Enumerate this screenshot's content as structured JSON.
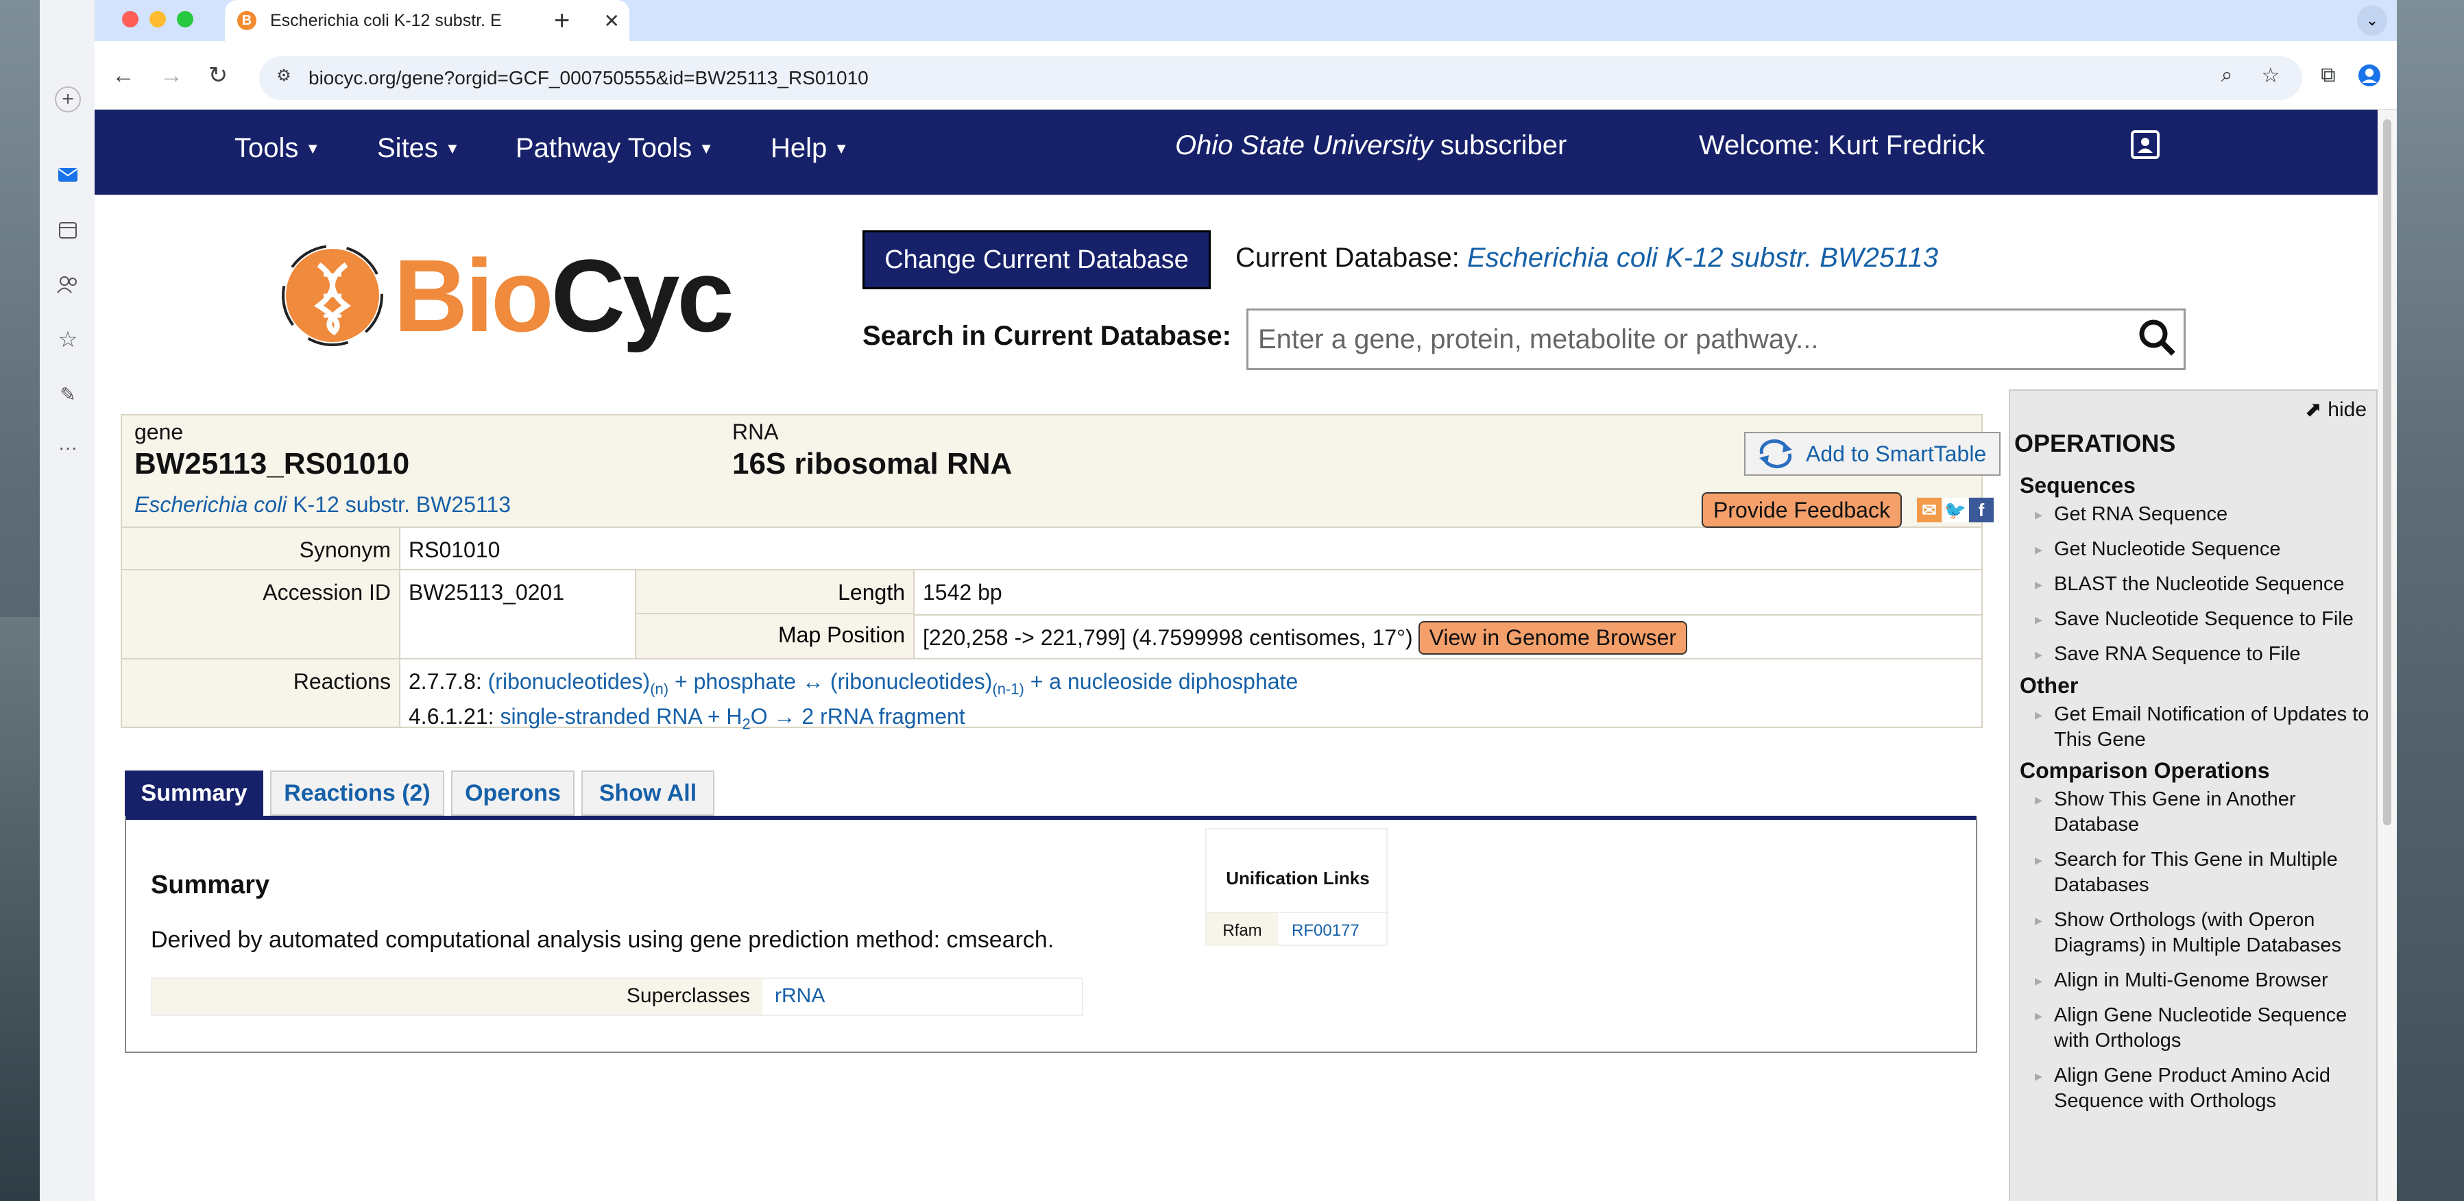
{
  "browser": {
    "tab_title": "Escherichia coli K-12 substr. E",
    "url": "biocyc.org/gene?orgid=GCF_000750555&id=BW25113_RS01010",
    "favicon_letter": "B"
  },
  "nav": {
    "menus": [
      "Tools",
      "Sites",
      "Pathway Tools",
      "Help"
    ],
    "subscriber_org": "Ohio State University",
    "subscriber_suffix": "subscriber",
    "welcome": "Welcome: Kurt Fredrick"
  },
  "logo": {
    "part1": "Bio",
    "part2": "Cyc"
  },
  "database": {
    "change_button": "Change Current Database",
    "current_label": "Current Database:",
    "current_name": "Escherichia coli K-12 substr. BW25113",
    "search_label": "Search in Current Database:",
    "search_placeholder": "Enter a gene, protein, metabolite or pathway..."
  },
  "gene": {
    "type_label": "gene",
    "id": "BW25113_RS01010",
    "organism_italic": "Escherichia coli",
    "organism_rest": " K-12 substr. BW25113",
    "product_type": "RNA",
    "product_name": "16S ribosomal RNA",
    "smarttable_button": "Add to SmartTable",
    "feedback_button": "Provide Feedback"
  },
  "properties": {
    "synonym_label": "Synonym",
    "synonym_value": "RS01010",
    "accession_label": "Accession ID",
    "accession_value": "BW25113_0201",
    "length_label": "Length",
    "length_value": "1542 bp",
    "map_label": "Map Position",
    "map_value": "[220,258 -> 221,799] (4.7599998 centisomes, 17°)",
    "genome_button": "View in Genome Browser",
    "reactions_label": "Reactions",
    "reaction1_ec": "2.7.7.8:",
    "reaction1_a": "(ribonucleotides)",
    "reaction1_a_sub": "(n)",
    "reaction1_b": " + phosphate ↔ (ribonucleotides)",
    "reaction1_b_sub": "(n-1)",
    "reaction1_c": " + a nucleoside diphosphate",
    "reaction2_ec": "4.6.1.21:",
    "reaction2_a": "single-stranded RNA + H",
    "reaction2_sub": "2",
    "reaction2_b": "O → 2 rRNA fragment"
  },
  "tabs": [
    "Summary",
    "Reactions (2)",
    "Operons",
    "Show All"
  ],
  "summary": {
    "heading": "Summary",
    "description": "Derived by automated computational analysis using gene prediction method: cmsearch.",
    "superclasses_label": "Superclasses",
    "superclasses_value": "rRNA",
    "unification_title": "Unification Links",
    "rfam_label": "Rfam",
    "rfam_value": "RF00177"
  },
  "operations": {
    "hide": "hide",
    "title": "OPERATIONS",
    "sequences_heading": "Sequences",
    "sequences": [
      "Get RNA Sequence",
      "Get Nucleotide Sequence",
      "BLAST the Nucleotide Sequence",
      "Save Nucleotide Sequence to File",
      "Save RNA Sequence to File"
    ],
    "other_heading": "Other",
    "other": [
      "Get Email Notification of Updates to This Gene"
    ],
    "comparison_heading": "Comparison Operations",
    "comparison": [
      "Show This Gene in Another Database",
      "Search for This Gene in Multiple Databases",
      "Show Orthologs (with Operon Diagrams) in Multiple Databases",
      "Align in Multi-Genome Browser",
      "Align Gene Nucleotide Sequence with Orthologs",
      "Align Gene Product Amino Acid Sequence with Orthologs"
    ]
  }
}
